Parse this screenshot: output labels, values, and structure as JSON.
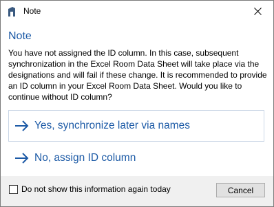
{
  "window": {
    "title": "Note",
    "close_icon": "close-icon",
    "app_icon": "building-icon"
  },
  "content": {
    "heading": "Note",
    "message": "You have not assigned the ID column. In this case, subsequent synchronization in the Excel Room Data Sheet will take place via the designations and will fail if these change. It is recommended to provide an ID column in your Excel Room Data Sheet. Would you like to continue without ID column?"
  },
  "commands": [
    {
      "label": "Yes, synchronize later via names",
      "icon": "arrow-right-icon"
    },
    {
      "label": "No, assign ID column",
      "icon": "arrow-right-icon"
    }
  ],
  "footer": {
    "checkbox_label": "Do not show this information again today",
    "checkbox_checked": false,
    "cancel_label": "Cancel"
  },
  "colors": {
    "accent": "#1c5aa6",
    "footer_bg": "#f0f0f0",
    "command_border": "#c9d6e6"
  }
}
